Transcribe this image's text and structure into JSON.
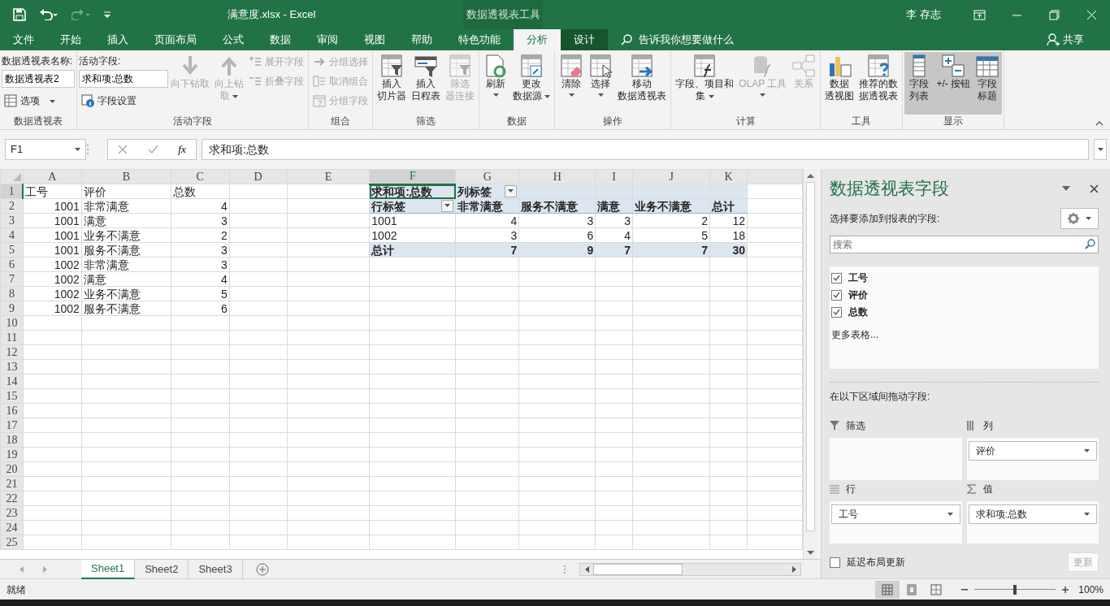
{
  "window": {
    "title": "满意度.xlsx  -  Excel",
    "context_group": "数据透视表工具",
    "user": "李 存志"
  },
  "ribbon_tabs": [
    {
      "label": "文件",
      "selected": false,
      "context": false
    },
    {
      "label": "开始",
      "selected": false,
      "context": false
    },
    {
      "label": "插入",
      "selected": false,
      "context": false
    },
    {
      "label": "页面布局",
      "selected": false,
      "context": false
    },
    {
      "label": "公式",
      "selected": false,
      "context": false
    },
    {
      "label": "数据",
      "selected": false,
      "context": false
    },
    {
      "label": "审阅",
      "selected": false,
      "context": false
    },
    {
      "label": "视图",
      "selected": false,
      "context": false
    },
    {
      "label": "帮助",
      "selected": false,
      "context": false
    },
    {
      "label": "特色功能",
      "selected": false,
      "context": false
    },
    {
      "label": "分析",
      "selected": true,
      "context": true
    },
    {
      "label": "设计",
      "selected": false,
      "context": true
    }
  ],
  "tell_me": "告诉我你想要做什么",
  "share": "共享",
  "ribbon_groups": [
    {
      "label": "数据透视表",
      "controls": [
        {
          "kind": "caption",
          "label": "数据透视表名称:"
        },
        {
          "kind": "field",
          "value": "数据透视表2"
        },
        {
          "kind": "small",
          "label": "选项",
          "dropdown": true,
          "disabled": false
        }
      ]
    },
    {
      "label": "活动字段",
      "controls": [
        {
          "kind": "caption",
          "label": "活动字段:"
        },
        {
          "kind": "field",
          "value": "求和项:总数"
        },
        {
          "kind": "small",
          "label": "字段设置",
          "dropdown": false,
          "disabled": false
        },
        {
          "kind": "large",
          "label": "向下钻取",
          "dropdown": false,
          "disabled": true
        },
        {
          "kind": "large",
          "label": "向上钻取",
          "dropdown": true,
          "disabled": true
        },
        {
          "kind": "small",
          "label": "展开字段",
          "dropdown": false,
          "disabled": true
        },
        {
          "kind": "small",
          "label": "折叠字段",
          "dropdown": false,
          "disabled": true
        }
      ]
    },
    {
      "label": "组合",
      "controls": [
        {
          "kind": "small",
          "label": "分组选择",
          "dropdown": false,
          "disabled": true
        },
        {
          "kind": "small",
          "label": "取消组合",
          "dropdown": false,
          "disabled": true
        },
        {
          "kind": "small",
          "label": "分组字段",
          "dropdown": false,
          "disabled": true
        }
      ]
    },
    {
      "label": "筛选",
      "controls": [
        {
          "kind": "large",
          "label": "插入切片器",
          "dropdown": false,
          "disabled": false
        },
        {
          "kind": "large",
          "label": "插入日程表",
          "dropdown": false,
          "disabled": false
        },
        {
          "kind": "large",
          "label": "筛选器连接",
          "dropdown": false,
          "disabled": true
        }
      ]
    },
    {
      "label": "数据",
      "controls": [
        {
          "kind": "large",
          "label": "刷新",
          "dropdown": true,
          "disabled": false
        },
        {
          "kind": "large",
          "label": "更改数据源",
          "dropdown": true,
          "disabled": false
        }
      ]
    },
    {
      "label": "操作",
      "controls": [
        {
          "kind": "large",
          "label": "清除",
          "dropdown": true,
          "disabled": false
        },
        {
          "kind": "large",
          "label": "选择",
          "dropdown": true,
          "disabled": false
        },
        {
          "kind": "large",
          "label": "移动数据透视表",
          "dropdown": false,
          "disabled": false
        }
      ]
    },
    {
      "label": "计算",
      "controls": [
        {
          "kind": "large",
          "label": "字段、项目和集",
          "dropdown": true,
          "disabled": false
        },
        {
          "kind": "large",
          "label": "OLAP 工具",
          "dropdown": true,
          "disabled": true
        },
        {
          "kind": "large",
          "label": "关系",
          "dropdown": false,
          "disabled": true
        }
      ]
    },
    {
      "label": "工具",
      "controls": [
        {
          "kind": "large",
          "label": "数据透视图",
          "dropdown": false,
          "disabled": false
        },
        {
          "kind": "large",
          "label": "推荐的数据透视表",
          "dropdown": false,
          "disabled": false
        }
      ]
    },
    {
      "label": "显示",
      "controls": [
        {
          "kind": "large",
          "label": "字段列表",
          "dropdown": false,
          "disabled": false,
          "selected": true
        },
        {
          "kind": "large",
          "label": "+/- 按钮",
          "dropdown": false,
          "disabled": false,
          "selected": true
        },
        {
          "kind": "large",
          "label": "字段标题",
          "dropdown": false,
          "disabled": false,
          "selected": true
        }
      ]
    }
  ],
  "formula_bar": {
    "name_box": "F1",
    "function_button": "fx",
    "formula": "求和项:总数"
  },
  "sheet": {
    "columns": [
      {
        "label": "A",
        "selected": false
      },
      {
        "label": "B",
        "selected": false
      },
      {
        "label": "C",
        "selected": false
      },
      {
        "label": "D",
        "selected": false
      },
      {
        "label": "E",
        "selected": false
      },
      {
        "label": "F",
        "selected": true
      },
      {
        "label": "G",
        "selected": false
      },
      {
        "label": "H",
        "selected": false
      },
      {
        "label": "I",
        "selected": false
      },
      {
        "label": "J",
        "selected": false
      },
      {
        "label": "K",
        "selected": false
      }
    ],
    "rows": [
      {
        "label": "1",
        "selected": true
      },
      {
        "label": "2",
        "selected": false
      },
      {
        "label": "3",
        "selected": false
      },
      {
        "label": "4",
        "selected": false
      },
      {
        "label": "5",
        "selected": false
      },
      {
        "label": "6",
        "selected": false
      },
      {
        "label": "7",
        "selected": false
      },
      {
        "label": "8",
        "selected": false
      },
      {
        "label": "9",
        "selected": false
      },
      {
        "label": "10",
        "selected": false
      },
      {
        "label": "11",
        "selected": false
      },
      {
        "label": "12",
        "selected": false
      },
      {
        "label": "13",
        "selected": false
      },
      {
        "label": "14",
        "selected": false
      },
      {
        "label": "15",
        "selected": false
      },
      {
        "label": "16",
        "selected": false
      },
      {
        "label": "17",
        "selected": false
      },
      {
        "label": "18",
        "selected": false
      },
      {
        "label": "19",
        "selected": false
      },
      {
        "label": "20",
        "selected": false
      },
      {
        "label": "21",
        "selected": false
      },
      {
        "label": "22",
        "selected": false
      },
      {
        "label": "23",
        "selected": false
      },
      {
        "label": "24",
        "selected": false
      },
      {
        "label": "25",
        "selected": false
      }
    ],
    "data": {
      "fields": [
        {
          "header": "工号",
          "numeric": true
        },
        {
          "header": "评价",
          "numeric": false
        },
        {
          "header": "总数",
          "numeric": true
        }
      ],
      "records": [
        [
          "1001",
          "非常满意",
          "4"
        ],
        [
          "1001",
          "满意",
          "3"
        ],
        [
          "1001",
          "业务不满意",
          "2"
        ],
        [
          "1001",
          "服务不满意",
          "3"
        ],
        [
          "1002",
          "非常满意",
          "3"
        ],
        [
          "1002",
          "满意",
          "4"
        ],
        [
          "1002",
          "业务不满意",
          "5"
        ],
        [
          "1002",
          "服务不满意",
          "6"
        ]
      ]
    },
    "pivot": {
      "value_field": "求和项:总数",
      "column_label": "列标签",
      "row_label": "行标签",
      "columns": [
        "非常满意",
        "服务不满意",
        "满意",
        "业务不满意",
        "总计"
      ],
      "rows": [
        {
          "label": "1001",
          "values": [
            "4",
            "3",
            "3",
            "2",
            "12"
          ]
        },
        {
          "label": "1002",
          "values": [
            "3",
            "6",
            "4",
            "5",
            "18"
          ]
        }
      ],
      "total": {
        "label": "总计",
        "values": [
          "7",
          "9",
          "7",
          "7",
          "30"
        ]
      }
    }
  },
  "sheet_tabs": [
    {
      "label": "Sheet1",
      "selected": true
    },
    {
      "label": "Sheet2",
      "selected": false
    },
    {
      "label": "Sheet3",
      "selected": false
    }
  ],
  "field_pane": {
    "title": "数据透视表字段",
    "prompt": "选择要添加到报表的字段:",
    "search_placeholder": "搜索",
    "fields": [
      {
        "label": "工号",
        "checked": true
      },
      {
        "label": "评价",
        "checked": true
      },
      {
        "label": "总数",
        "checked": true
      }
    ],
    "more_tables": "更多表格...",
    "areas_prompt": "在以下区域间拖动字段:",
    "areas": [
      {
        "kind": "filter",
        "label": "筛选"
      },
      {
        "kind": "columns",
        "label": "列",
        "items": [
          "评价"
        ]
      },
      {
        "kind": "rows",
        "label": "行",
        "items": [
          "工号"
        ]
      },
      {
        "kind": "values",
        "label": "值",
        "items": [
          "求和项:总数"
        ]
      }
    ],
    "defer": {
      "label": "延迟布局更新",
      "checked": false
    },
    "update_button": {
      "label": "更新",
      "disabled": true
    }
  },
  "status_bar": {
    "status": "就绪",
    "views": [
      {
        "kind": "normal",
        "selected": true
      },
      {
        "kind": "page_layout",
        "selected": false
      },
      {
        "kind": "page_break",
        "selected": false
      }
    ],
    "zoom": {
      "level": 0.5,
      "reading": "100%"
    }
  }
}
